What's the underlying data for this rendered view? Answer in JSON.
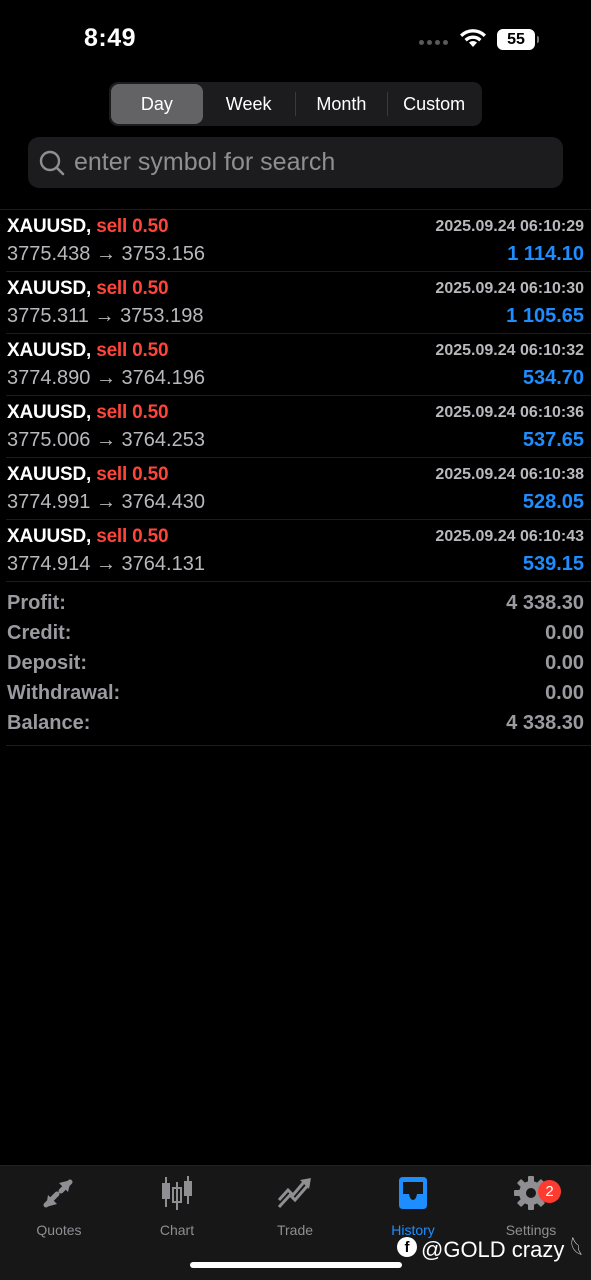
{
  "status_bar": {
    "time": "8:49",
    "battery": "55"
  },
  "period_tabs": [
    "Day",
    "Week",
    "Month",
    "Custom"
  ],
  "active_period": "Day",
  "search": {
    "placeholder": "enter symbol for search"
  },
  "trades": [
    {
      "symbol": "XAUUSD,",
      "type": "sell 0.50",
      "time": "2025.09.24 06:10:29",
      "open": "3775.438",
      "close": "3753.156",
      "profit": "1 114.10"
    },
    {
      "symbol": "XAUUSD,",
      "type": "sell 0.50",
      "time": "2025.09.24 06:10:30",
      "open": "3775.311",
      "close": "3753.198",
      "profit": "1 105.65"
    },
    {
      "symbol": "XAUUSD,",
      "type": "sell 0.50",
      "time": "2025.09.24 06:10:32",
      "open": "3774.890",
      "close": "3764.196",
      "profit": "534.70"
    },
    {
      "symbol": "XAUUSD,",
      "type": "sell 0.50",
      "time": "2025.09.24 06:10:36",
      "open": "3775.006",
      "close": "3764.253",
      "profit": "537.65"
    },
    {
      "symbol": "XAUUSD,",
      "type": "sell 0.50",
      "time": "2025.09.24 06:10:38",
      "open": "3774.991",
      "close": "3764.430",
      "profit": "528.05"
    },
    {
      "symbol": "XAUUSD,",
      "type": "sell 0.50",
      "time": "2025.09.24 06:10:43",
      "open": "3774.914",
      "close": "3764.131",
      "profit": "539.15"
    }
  ],
  "summary": [
    {
      "label": "Profit:",
      "value": "4 338.30"
    },
    {
      "label": "Credit:",
      "value": "0.00"
    },
    {
      "label": "Deposit:",
      "value": "0.00"
    },
    {
      "label": "Withdrawal:",
      "value": "0.00"
    },
    {
      "label": "Balance:",
      "value": "4 338.30"
    }
  ],
  "tabbar": {
    "items": [
      {
        "label": "Quotes",
        "icon": "quotes-icon"
      },
      {
        "label": "Chart",
        "icon": "candlestick-icon"
      },
      {
        "label": "Trade",
        "icon": "trade-icon"
      },
      {
        "label": "History",
        "icon": "inbox-icon"
      },
      {
        "label": "Settings",
        "icon": "gear-icon"
      }
    ],
    "active": "History",
    "settings_badge": "2"
  },
  "watermark": "@GOLD crazy 𓆩"
}
